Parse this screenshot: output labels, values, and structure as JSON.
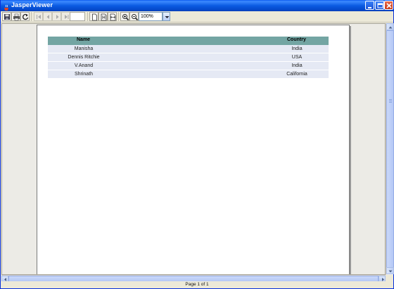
{
  "window": {
    "title": "JasperViewer"
  },
  "toolbar": {
    "page_number": "",
    "zoom_value": "100%"
  },
  "report": {
    "columns": [
      "Name",
      "Country"
    ],
    "rows": [
      [
        "Manisha",
        "India"
      ],
      [
        "Dennis Ritchie",
        "USA"
      ],
      [
        "V.Anand",
        "India"
      ],
      [
        "Shrinath",
        "California"
      ]
    ]
  },
  "colors": {
    "header_bg": "#73A5A3",
    "row_bg": "#E5E9F4",
    "title_bar": "#0B5BE3"
  },
  "status": {
    "page_info": "Page 1 of 1"
  }
}
